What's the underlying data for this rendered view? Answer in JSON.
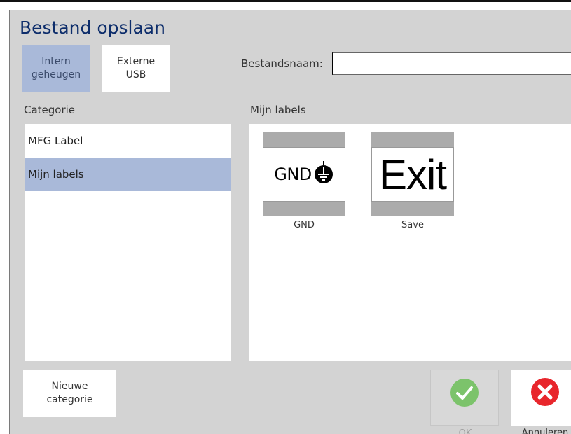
{
  "dialog": {
    "title": "Bestand opslaan"
  },
  "source": {
    "intern_label": "Intern\ngeheugen",
    "extern_label": "Externe\nUSB",
    "selected": "Intern geheugen"
  },
  "filename": {
    "label": "Bestandsnaam:",
    "value": ""
  },
  "categories": {
    "header": "Categorie",
    "items": [
      {
        "label": "MFG Label",
        "selected": false
      },
      {
        "label": "Mijn labels",
        "selected": true
      }
    ]
  },
  "library": {
    "header": "Mijn labels",
    "labels": [
      {
        "name": "GND",
        "content": "GND",
        "icon": "ground-symbol-icon"
      },
      {
        "name": "Save",
        "content": "Exit"
      }
    ]
  },
  "buttons": {
    "new_category": "Nieuwe\ncategorie",
    "ok": "OK",
    "cancel": "Annuleren"
  },
  "colors": {
    "title": "#0d2d6b",
    "selected": "#a9b9d9",
    "ok_green": "#7cc36b",
    "cancel_red": "#e8262c"
  }
}
